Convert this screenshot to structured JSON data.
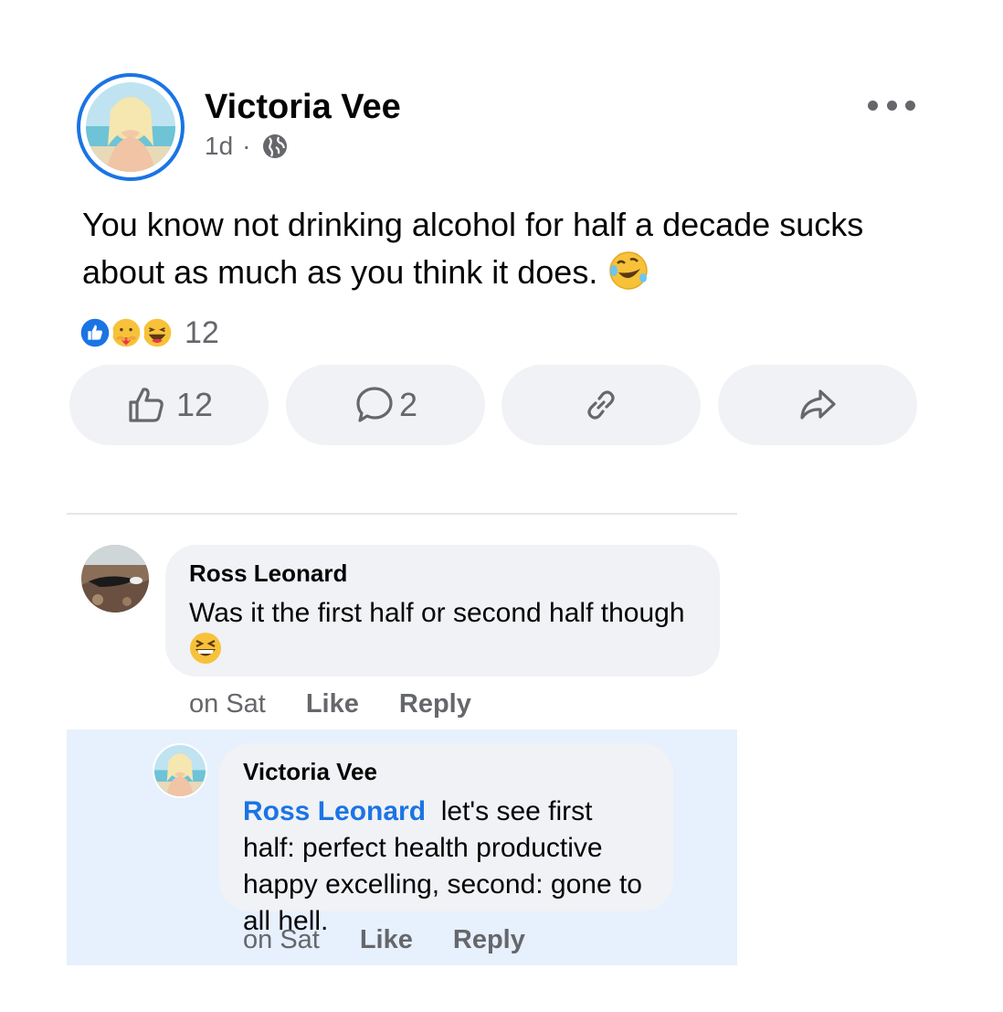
{
  "post": {
    "author": "Victoria Vee",
    "time": "1d",
    "separator": "·",
    "privacy_icon": "globe-icon",
    "text": "You know not drinking alcohol for half a decade sucks about as much as you think it does.",
    "text_emoji": "rolling-on-floor-laughing-emoji",
    "reactions": [
      "like-reaction",
      "care-reaction",
      "haha-reaction"
    ],
    "reaction_count": "12"
  },
  "actions": {
    "like_count": "12",
    "comment_count": "2",
    "copy_link_icon": "link-icon",
    "share_icon": "share-icon"
  },
  "comments": [
    {
      "author": "Ross Leonard",
      "text": "Was it the first half or second half though",
      "emoji": "grinning-squinting-emoji",
      "time": "on Sat",
      "like_label": "Like",
      "reply_label": "Reply"
    },
    {
      "author": "Victoria Vee",
      "mention": "Ross Leonard",
      "text": "let's see first half: perfect health productive happy excelling, second: gone to all hell.",
      "time": "on Sat",
      "like_label": "Like",
      "reply_label": "Reply"
    }
  ],
  "colors": {
    "accent": "#1b74e4",
    "bubble": "#f0f2f5",
    "highlight": "#e7f0fd",
    "secondary_text": "#65676b"
  }
}
